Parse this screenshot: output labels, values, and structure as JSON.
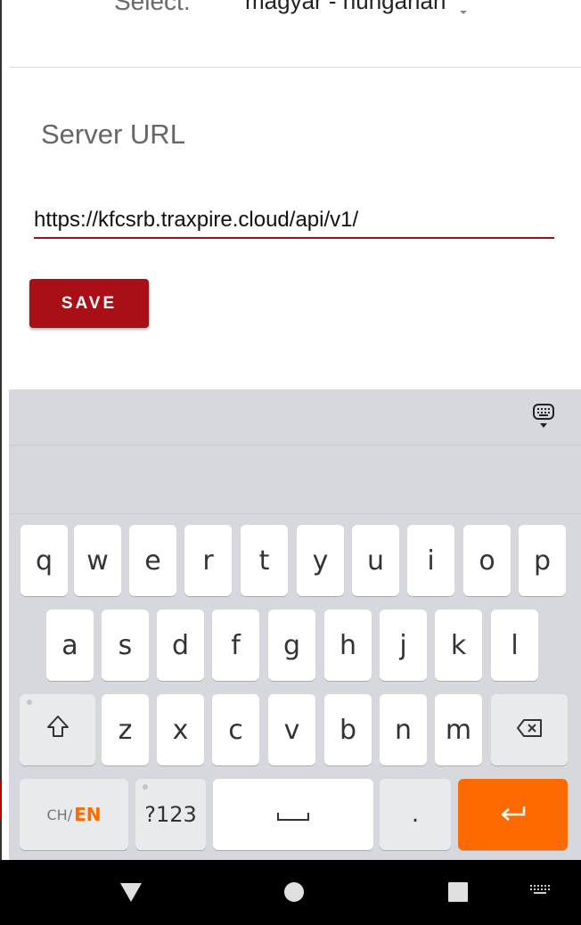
{
  "language": {
    "label": "Select:",
    "value": "magyar - hungarian"
  },
  "server": {
    "label": "Server URL",
    "url": "https://kfcsrb.traxpire.cloud/api/v1/",
    "save_label": "SAVE"
  },
  "keyboard": {
    "row1": [
      "q",
      "w",
      "e",
      "r",
      "t",
      "y",
      "u",
      "i",
      "o",
      "p"
    ],
    "row2": [
      "a",
      "s",
      "d",
      "f",
      "g",
      "h",
      "j",
      "k",
      "l"
    ],
    "row3": [
      "z",
      "x",
      "c",
      "v",
      "b",
      "n",
      "m"
    ],
    "lang_prefix": "CH/",
    "lang_active": "EN",
    "symbols_label": "?123",
    "period_label": ".",
    "icons": {
      "hide": "keyboard-hide-icon",
      "shift": "shift-icon",
      "backspace": "backspace-icon",
      "space": "space-icon",
      "enter": "enter-icon"
    }
  },
  "navbar": {
    "icons": [
      "back-icon",
      "home-icon",
      "recents-icon",
      "keyboard-switch-icon"
    ]
  },
  "colors": {
    "accent": "#a80f16",
    "enter_key": "#ff6a00",
    "keyboard_bg": "#d6d8dd"
  }
}
